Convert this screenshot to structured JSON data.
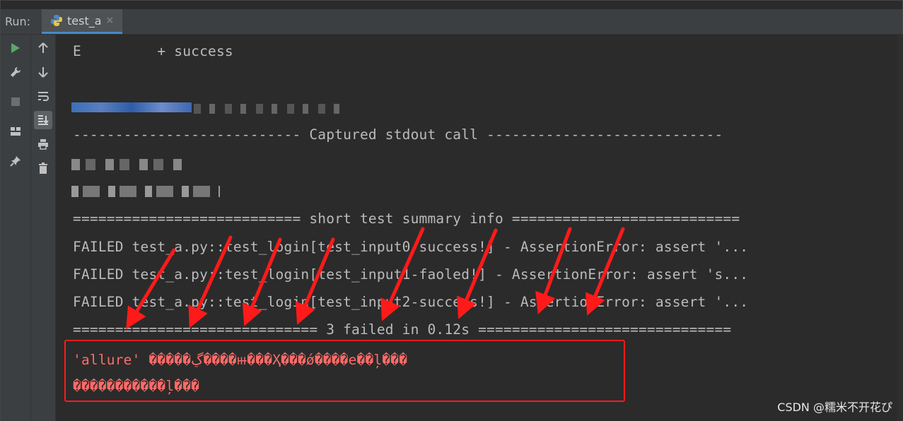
{
  "run_label": "Run:",
  "tab": {
    "label": "test_a",
    "close": "×"
  },
  "console_lines": [
    "E         + success",
    "--------------------------- Captured stdout call ----------------------------",
    "=========================== short test summary info ===========================",
    "FAILED test_a.py::test_login[test_input0-success!] - AssertionError: assert '...",
    "FAILED test_a.py::test_login[test_input1-faoled!] - AssertionError: assert 's...",
    "FAILED test_a.py::test_login[test_input2-success!] - AssertionError: assert '...",
    "============================= 3 failed in 0.12s =============================="
  ],
  "error_lines": [
    "'allure' �����ڲ����ⲿ���Ҳ���ǿ����е��ļ���",
    "�����������ļ���"
  ],
  "watermark": "CSDN @糯米不开花ぴ",
  "icons": {
    "run": "play-icon",
    "wrench": "wrench-icon",
    "stop": "stop-icon",
    "layout": "layout-icon",
    "pin": "pin-icon",
    "up": "arrow-up-icon",
    "down": "arrow-down-icon",
    "wrap": "soft-wrap-icon",
    "scroll_end": "scroll-to-end-icon",
    "print": "print-icon",
    "trash": "trash-icon"
  },
  "colors": {
    "background": "#2b2b2b",
    "panel": "#3c3f41",
    "text": "#bbbbbb",
    "error": "#ff6b68",
    "annotation": "#ff1a1a",
    "run_green": "#59a869"
  }
}
